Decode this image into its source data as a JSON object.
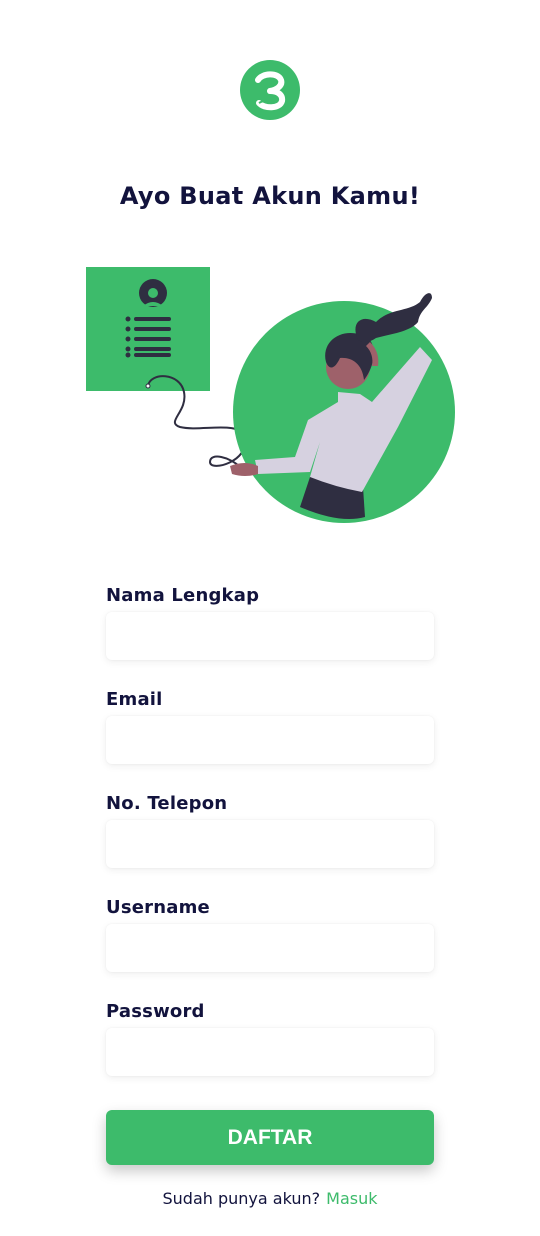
{
  "brand": {
    "logo_icon": "brand-logo-icon",
    "accent_color": "#3dbb6b",
    "text_color": "#12133d"
  },
  "header": {
    "title": "Ayo Buat Akun Kamu!"
  },
  "illustration": {
    "icon": "register-illustration"
  },
  "form": {
    "fields": [
      {
        "label": "Nama Lengkap",
        "value": ""
      },
      {
        "label": "Email",
        "value": ""
      },
      {
        "label": "No. Telepon",
        "value": ""
      },
      {
        "label": "Username",
        "value": ""
      },
      {
        "label": "Password",
        "value": ""
      }
    ],
    "submit_label": "DAFTAR"
  },
  "footer": {
    "prompt": "Sudah punya akun?",
    "login_link": "Masuk"
  }
}
